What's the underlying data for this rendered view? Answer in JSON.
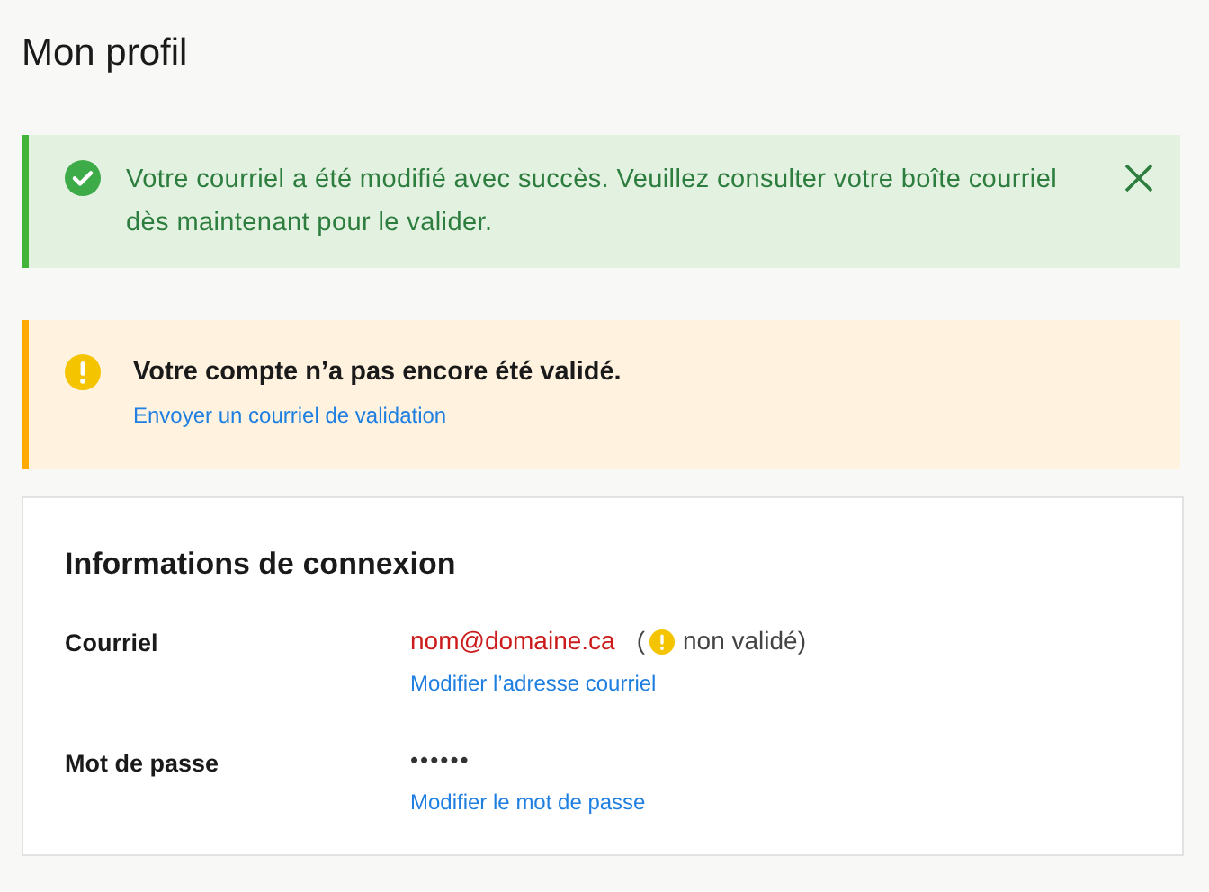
{
  "page_title": "Mon profil",
  "alerts": [
    {
      "kind": "success",
      "message": "Votre courriel a été modifié avec succès. Veuillez consulter votre boîte courriel dès maintenant pour le valider.",
      "dismissible": true
    },
    {
      "kind": "warning",
      "message": "Votre compte n’a pas encore été validé.",
      "link": "Envoyer un courriel de validation",
      "dismissible": false
    }
  ],
  "card": {
    "title": "Informations de connexion",
    "fields": [
      {
        "kind": "email",
        "label": "Courriel",
        "value": "nom@domaine.ca",
        "status_open": "(",
        "status": "non validé)",
        "link": "Modifier l’adresse courriel"
      },
      {
        "kind": "password",
        "label": "Mot de passe",
        "value": "••••••",
        "link": "Modifier le mot de passe"
      }
    ]
  }
}
